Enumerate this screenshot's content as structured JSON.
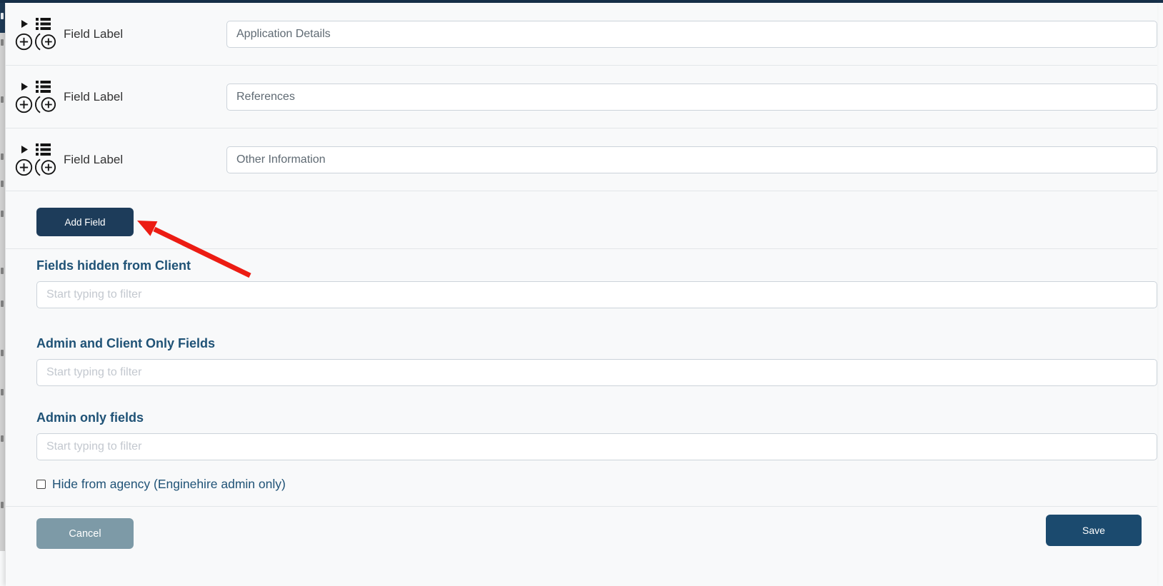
{
  "field_rows": [
    {
      "label": "Field Label",
      "value": "Application Details"
    },
    {
      "label": "Field Label",
      "value": "References"
    },
    {
      "label": "Field Label",
      "value": "Other Information"
    }
  ],
  "add_field": {
    "label": "Add Field"
  },
  "sections": [
    {
      "heading": "Fields hidden from Client",
      "placeholder": "Start typing to filter",
      "value": ""
    },
    {
      "heading": "Admin and Client Only Fields",
      "placeholder": "Start typing to filter",
      "value": ""
    },
    {
      "heading": "Admin only fields",
      "placeholder": "Start typing to filter",
      "value": ""
    }
  ],
  "checkbox": {
    "label": "Hide from agency (Enginehire admin only)",
    "checked": false
  },
  "footer": {
    "cancel_label": "Cancel",
    "save_label": "Save"
  },
  "icons": {
    "row_expand": "caret-right-icon",
    "row_reorder": "list-icon",
    "row_add": "circle-plus-icon",
    "row_add_nested": "circle-plus-nested-icon"
  },
  "colors": {
    "topbar": "#17304a",
    "heading_text": "#1f5276",
    "add_field_button": "#1d3c5a",
    "save_button": "#1b4a6e",
    "cancel_button": "#7d9aa7",
    "annotation_arrow": "#ec1c13",
    "page_background": "#f8f9fa"
  }
}
